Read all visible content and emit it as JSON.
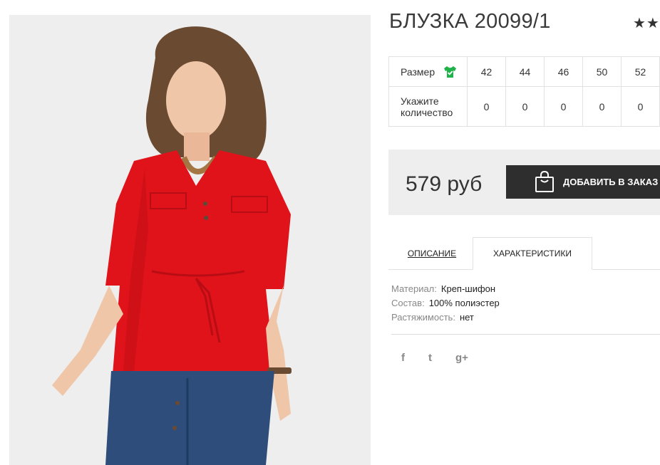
{
  "product": {
    "title": "БЛУЗКА 20099/1",
    "rating_stars": "★★"
  },
  "size_table": {
    "size_label": "Размер",
    "qty_label_line1": "Укажите",
    "qty_label_line2": "количество",
    "sizes": [
      "42",
      "44",
      "46",
      "50",
      "52"
    ],
    "quantities": [
      "0",
      "0",
      "0",
      "0",
      "0"
    ],
    "size_icon": "tshirt-check-icon",
    "size_icon_color": "#1fb24a"
  },
  "price": {
    "value": "579 руб",
    "add_button_label": "ДОБАВИТЬ В ЗАКАЗ",
    "add_button_icon": "shopping-bag-icon"
  },
  "tabs": {
    "description": "ОПИСАНИЕ",
    "characteristics": "ХАРАКТЕРИСТИКИ",
    "active": "characteristics"
  },
  "characteristics": [
    {
      "key": "Материал:",
      "value": "Креп-шифон"
    },
    {
      "key": "Состав:",
      "value": "100% полиэстер"
    },
    {
      "key": "Растяжимость:",
      "value": "нет"
    }
  ],
  "social": {
    "facebook": "f",
    "twitter": "t",
    "google_plus": "g+"
  },
  "colors": {
    "button_bg": "#2e2e2e",
    "price_box_bg": "#eeeeee",
    "blouse": "#e0121a"
  }
}
